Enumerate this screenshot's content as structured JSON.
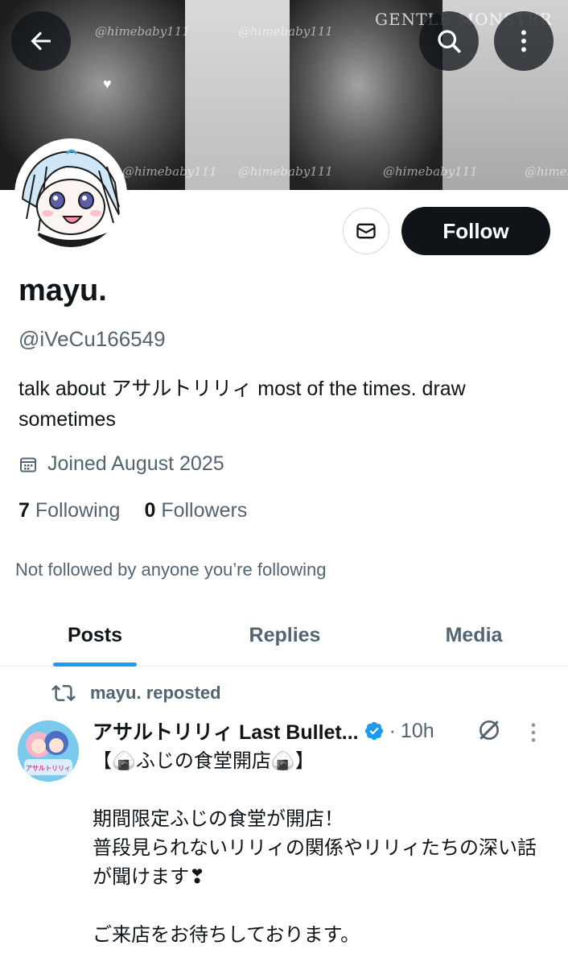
{
  "banner": {
    "watermark": "@himebaby111",
    "brand_text": "GENTLE MONSTER"
  },
  "header_icons": {
    "back": "arrow-left-icon",
    "search": "search-icon",
    "more": "more-vertical-icon"
  },
  "profile": {
    "display_name": "mayu.",
    "handle": "@iVeCu166549",
    "bio": "talk about アサルトリリィ most of the times. draw sometimes",
    "joined": "Joined August 2025",
    "following_count": "7",
    "following_label": "Following",
    "followers_count": "0",
    "followers_label": "Followers",
    "not_followed_text": "Not followed by anyone you’re following"
  },
  "actions": {
    "follow_label": "Follow",
    "message_icon": "mail-icon"
  },
  "tabs": [
    {
      "label": "Posts",
      "active": true
    },
    {
      "label": "Replies",
      "active": false
    },
    {
      "label": "Media",
      "active": false
    }
  ],
  "post": {
    "repost_text": "mayu. reposted",
    "author": "アサルトリリィ Last Bullet...",
    "verified": true,
    "dot": "·",
    "time": "10h",
    "avatar_text": "アサルトリリィ",
    "body_lines": [
      "【🍙ふじの食堂開店🍙】",
      "",
      "期間限定ふじの食堂が開店！",
      "普段見られないリリィの関係やリリィたちの深い話が聞けます❣",
      "",
      "ご来店をお待ちしております。"
    ]
  },
  "colors": {
    "accent": "#1d9bf0",
    "text_primary": "#0f1419",
    "text_secondary": "#536471",
    "follow_bg": "#0f1419"
  }
}
